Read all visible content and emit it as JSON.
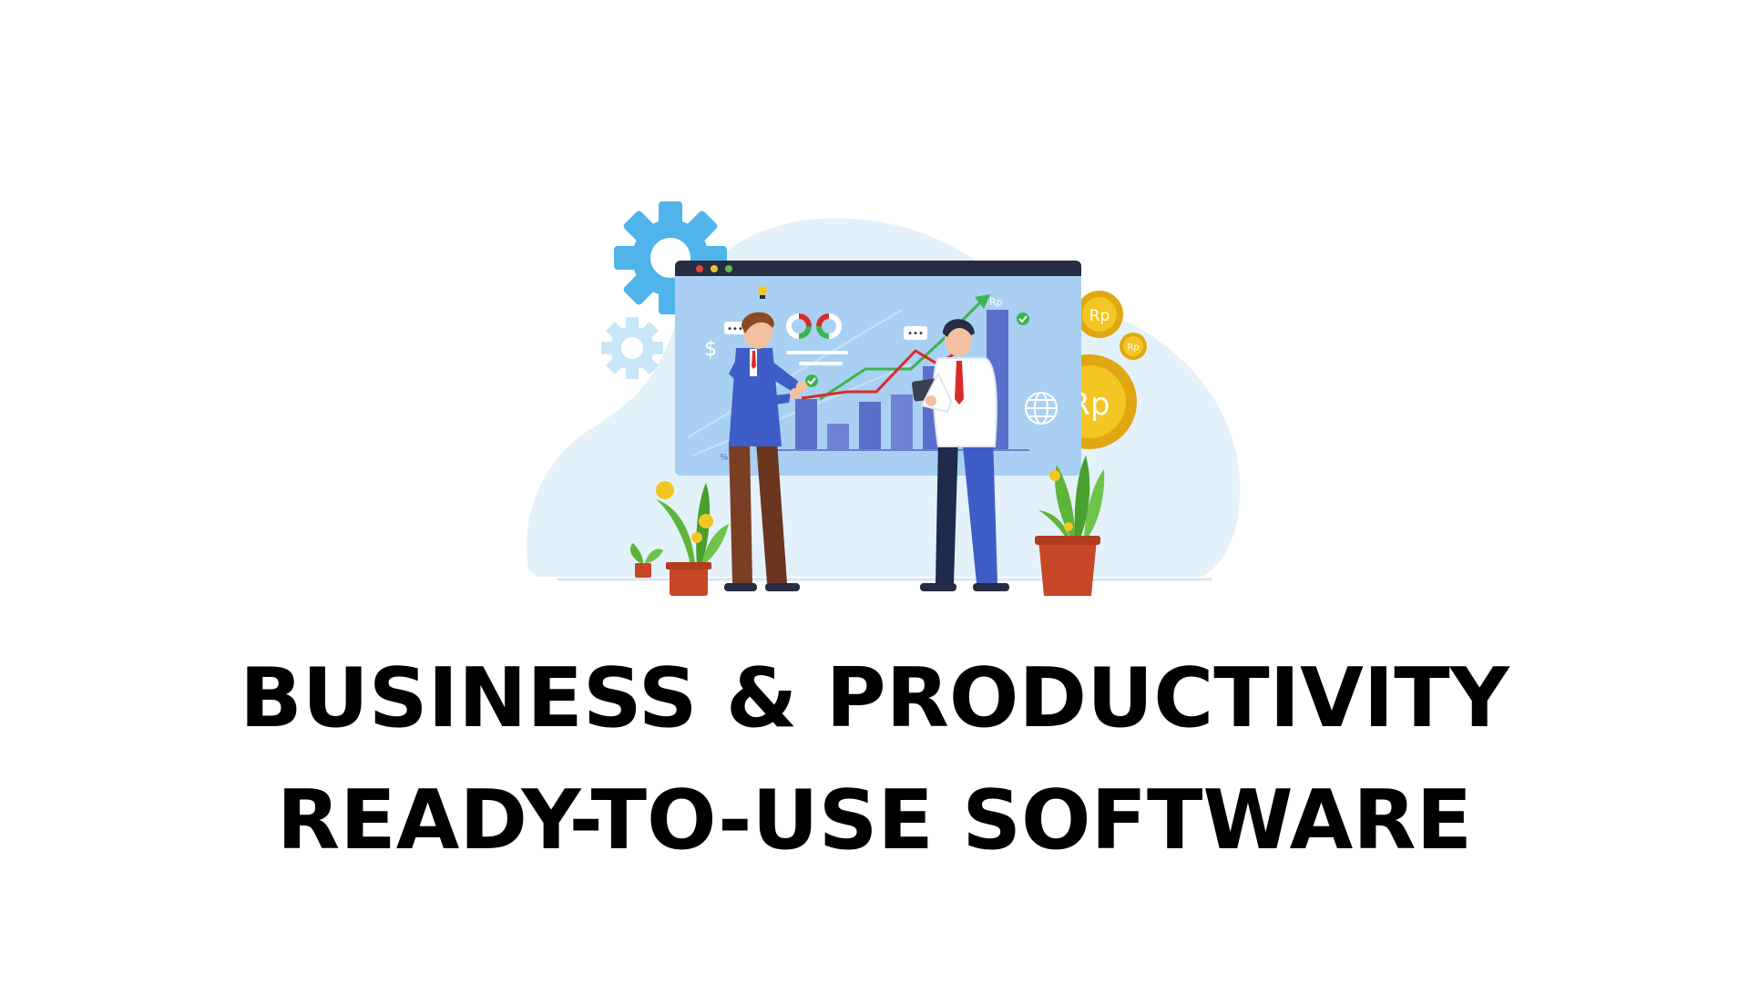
{
  "headline": {
    "line1": "BUSINESS & PRODUCTIVITY",
    "line2": "READY-TO-USE SOFTWARE"
  },
  "illustration": {
    "coin_label": "Rp",
    "dollar_sign": "$",
    "percent_sign": "%",
    "chat_dots": "•••"
  },
  "colors": {
    "blob": "#e3f2fa",
    "screen": "#a9d0f2",
    "window_bar": "#262d42",
    "bar_chart": "#5a6fc9",
    "gear_dark": "#4fb4ea",
    "gear_light": "#c9e6f8",
    "coin": "#f3c623",
    "coin_dark": "#e0a712",
    "plant": "#5fb43a",
    "pot": "#c74625",
    "line_green": "#3fb34f",
    "line_red": "#d92a2a"
  }
}
